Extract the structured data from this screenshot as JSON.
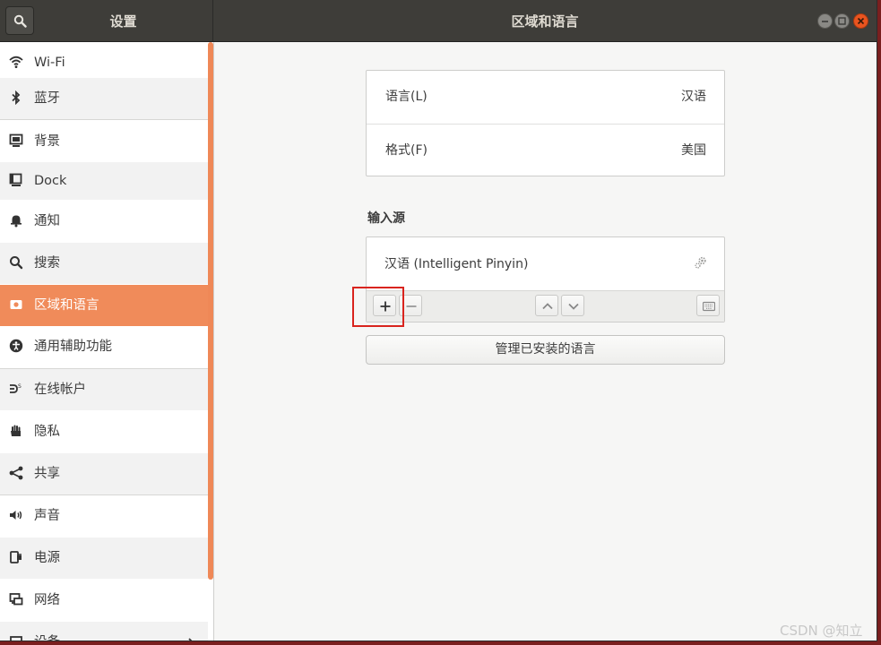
{
  "header": {
    "left_title": "设置",
    "main_title": "区域和语言"
  },
  "sidebar": {
    "items": [
      {
        "label": "Wi-Fi",
        "icon": "wifi-icon"
      },
      {
        "label": "蓝牙",
        "icon": "bluetooth-icon"
      },
      {
        "label": "背景",
        "icon": "background-icon"
      },
      {
        "label": "Dock",
        "icon": "dock-icon"
      },
      {
        "label": "通知",
        "icon": "bell-icon"
      },
      {
        "label": "搜索",
        "icon": "search-icon"
      },
      {
        "label": "区域和语言",
        "icon": "region-icon"
      },
      {
        "label": "通用辅助功能",
        "icon": "accessibility-icon"
      },
      {
        "label": "在线帐户",
        "icon": "online-accounts-icon"
      },
      {
        "label": "隐私",
        "icon": "hand-icon"
      },
      {
        "label": "共享",
        "icon": "share-icon"
      },
      {
        "label": "声音",
        "icon": "speaker-icon"
      },
      {
        "label": "电源",
        "icon": "power-icon"
      },
      {
        "label": "网络",
        "icon": "network-icon"
      },
      {
        "label": "设备",
        "icon": "devices-icon"
      }
    ],
    "active_index": 6
  },
  "main": {
    "language_label": "语言(L)",
    "language_value": "汉语",
    "format_label": "格式(F)",
    "format_value": "美国",
    "input_sources_title": "输入源",
    "input_source": "汉语 (Intelligent Pinyin)",
    "manage_button": "管理已安装的语言"
  },
  "watermark": "CSDN @知立",
  "colors": {
    "accent": "#f08b5a",
    "header": "#3e3d39",
    "close": "#e9541f",
    "highlight": "#d9241e"
  }
}
